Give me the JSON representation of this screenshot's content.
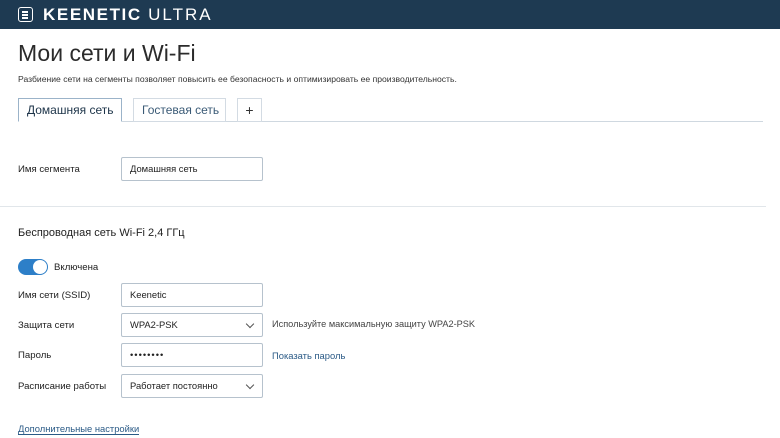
{
  "app": {
    "brand_bold": "KEENETIC",
    "brand_light": "ULTRA"
  },
  "page": {
    "title": "Мои сети и Wi-Fi",
    "description": "Разбиение сети на сегменты позволяет повысить ее безопасность и оптимизировать ее производительность."
  },
  "tabs": [
    {
      "label": "Домашняя сеть",
      "active": true
    },
    {
      "label": "Гостевая сеть",
      "active": false
    },
    {
      "label": "+",
      "active": false
    }
  ],
  "segment": {
    "label": "Имя сегмента",
    "value": "Домашняя сеть"
  },
  "wifi": {
    "section_title": "Беспроводная сеть Wi-Fi 2,4 ГГц",
    "toggle_label": "Включена",
    "toggle_on": true,
    "ssid": {
      "label": "Имя сети (SSID)",
      "value": "Keenetic"
    },
    "security": {
      "label": "Защита сети",
      "value": "WPA2-PSK",
      "hint": "Используйте максимальную защиту WPA2-PSK"
    },
    "password": {
      "label": "Пароль",
      "value": "••••••••",
      "show_link": "Показать пароль"
    },
    "schedule": {
      "label": "Расписание работы",
      "value": "Работает постоянно"
    },
    "advanced_link": "Дополнительные настройки"
  },
  "colors": {
    "topbar": "#1e3a52",
    "accent": "#2d7fc8",
    "link": "#2a5a86"
  }
}
